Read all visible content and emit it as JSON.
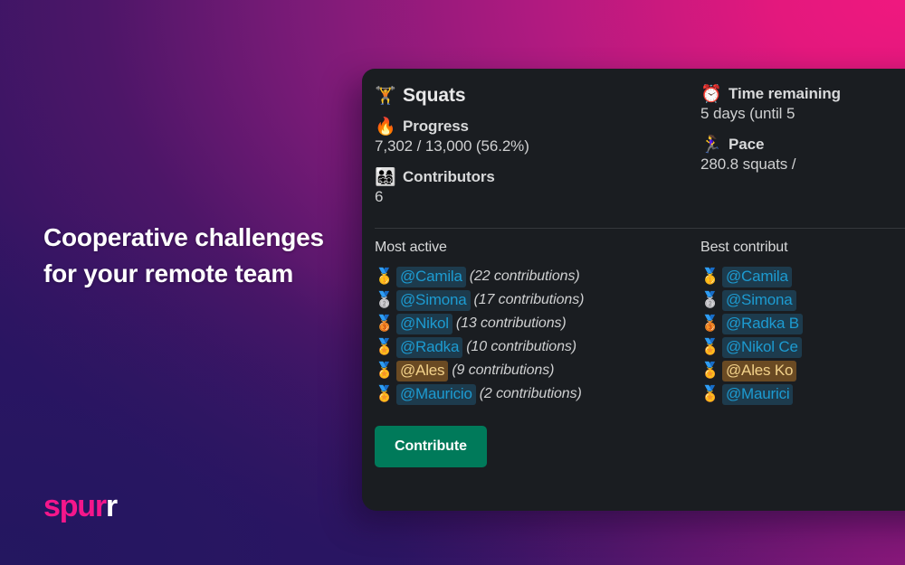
{
  "background": {
    "gradient_from": "#6b1a72",
    "gradient_pink": "#e8187f",
    "gradient_to": "#231760"
  },
  "headline": {
    "text": "Cooperative challenges for your remote team"
  },
  "logo": {
    "part_one": "spur",
    "part_two": "r",
    "color_primary": "#f5168b",
    "color_secondary": "#ffffff"
  },
  "card": {
    "background": "#1a1d21",
    "header": {
      "icon": "weight-lifter-emoji",
      "emoji": "🏋️",
      "title": "Squats"
    },
    "stats": [
      {
        "icon": "fire-emoji",
        "emoji": "🔥",
        "label": "Progress",
        "value": "7,302 / 13,000 (56.2%)"
      },
      {
        "icon": "alarm-clock-emoji",
        "emoji": "⏰",
        "label": "Time remaining",
        "value": "5 days (until 5"
      },
      {
        "icon": "family-emoji",
        "emoji": "👨‍👩‍👧‍👦",
        "label": "Contributors",
        "value": "6"
      },
      {
        "icon": "runner-emoji",
        "emoji": "🏃‍♀️",
        "label": "Pace",
        "value": "280.8 squats /"
      }
    ],
    "lists": [
      {
        "title": "Most active",
        "entries": [
          {
            "medal": "🥇",
            "medal_name": "gold-medal-emoji",
            "mention": "@Camila",
            "highlight": false,
            "contributions": "(22 contributions)"
          },
          {
            "medal": "🥈",
            "medal_name": "silver-medal-emoji",
            "mention": "@Simona",
            "highlight": false,
            "contributions": "(17 contributions)"
          },
          {
            "medal": "🥉",
            "medal_name": "bronze-medal-emoji",
            "mention": "@Nikol",
            "highlight": false,
            "contributions": "(13 contributions)"
          },
          {
            "medal": "🏅",
            "medal_name": "sports-medal-emoji",
            "mention": "@Radka",
            "highlight": false,
            "contributions": "(10 contributions)"
          },
          {
            "medal": "🏅",
            "medal_name": "sports-medal-emoji",
            "mention": "@Ales",
            "highlight": true,
            "contributions": "(9 contributions)"
          },
          {
            "medal": "🏅",
            "medal_name": "sports-medal-emoji",
            "mention": "@Mauricio",
            "highlight": false,
            "contributions": "(2 contributions)"
          }
        ]
      },
      {
        "title": "Best contribut",
        "entries": [
          {
            "medal": "🥇",
            "medal_name": "gold-medal-emoji",
            "mention": "@Camila",
            "highlight": false,
            "contributions": ""
          },
          {
            "medal": "🥈",
            "medal_name": "silver-medal-emoji",
            "mention": "@Simona",
            "highlight": false,
            "contributions": ""
          },
          {
            "medal": "🥉",
            "medal_name": "bronze-medal-emoji",
            "mention": "@Radka B",
            "highlight": false,
            "contributions": ""
          },
          {
            "medal": "🏅",
            "medal_name": "sports-medal-emoji",
            "mention": "@Nikol Ce",
            "highlight": false,
            "contributions": ""
          },
          {
            "medal": "🏅",
            "medal_name": "sports-medal-emoji",
            "mention": "@Ales Ko",
            "highlight": true,
            "contributions": ""
          },
          {
            "medal": "🏅",
            "medal_name": "sports-medal-emoji",
            "mention": "@Maurici",
            "highlight": false,
            "contributions": ""
          }
        ]
      }
    ],
    "action": {
      "label": "Contribute",
      "color": "#007a5a"
    }
  }
}
